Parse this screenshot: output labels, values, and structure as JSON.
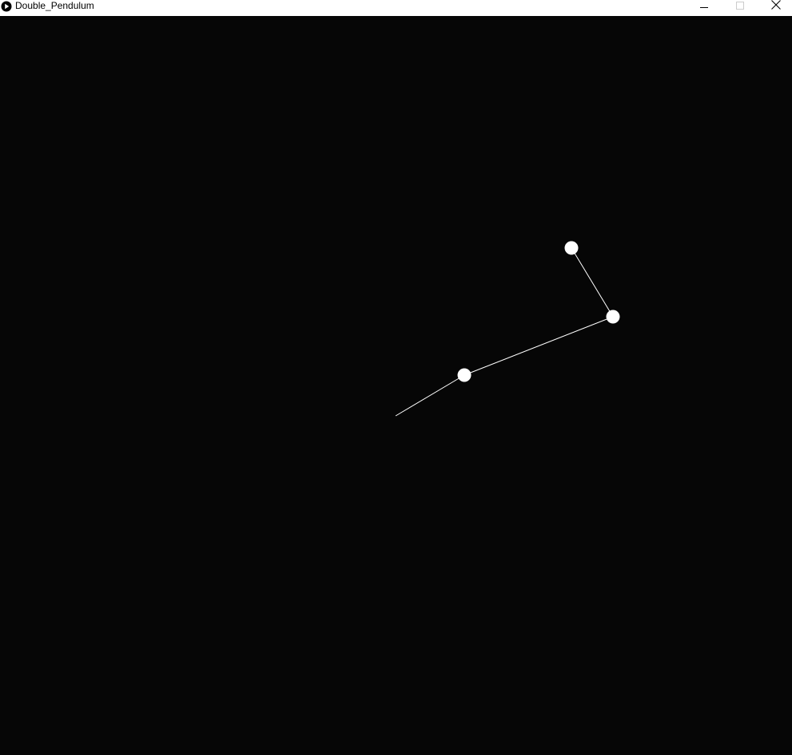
{
  "window": {
    "title": "Double_Pendulum",
    "app_icon": "processing-play-icon",
    "controls": {
      "minimize_icon": "minimize-icon",
      "maximize_icon": "maximize-icon",
      "close_icon": "close-icon"
    }
  },
  "canvas": {
    "background_color": "#060606",
    "line_color": "#ffffff",
    "bob_color": "#ffffff"
  }
}
